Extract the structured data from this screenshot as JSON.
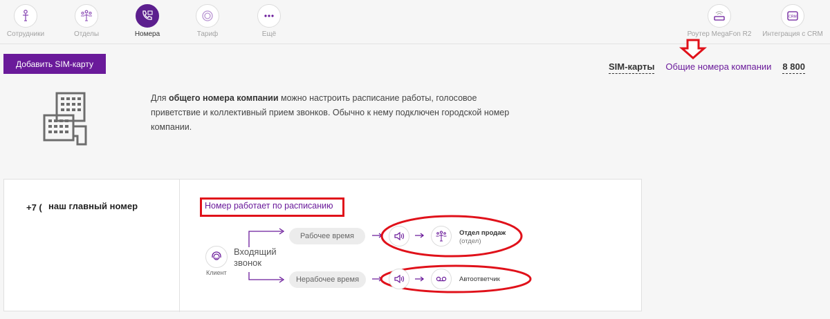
{
  "nav": {
    "items": [
      {
        "label": "Сотрудники",
        "icon": "employee-icon"
      },
      {
        "label": "Отделы",
        "icon": "departments-icon"
      },
      {
        "label": "Номера",
        "icon": "phone-icon"
      },
      {
        "label": "Тариф",
        "icon": "tariff-icon"
      },
      {
        "label": "Ещё",
        "icon": "more-icon"
      }
    ],
    "right_items": [
      {
        "label": "Роутер MegaFon R2",
        "icon": "router-icon"
      },
      {
        "label": "Интеграция с CRM",
        "icon": "crm-icon",
        "badge": "CRM"
      }
    ]
  },
  "toolbar": {
    "add_sim_label": "Добавить SIM-карту"
  },
  "tabs": {
    "sim": "SIM-карты",
    "company": "Общие номера компании",
    "eight": "8 800"
  },
  "info": {
    "prefix": "Для ",
    "bold": "общего номера компании",
    "rest": " можно настроить расписание работы, голосовое приветствие и коллективный прием звонков. Обычно к нему подключен городской номер компании."
  },
  "card": {
    "number": "+7 (",
    "name": "наш главный номер",
    "schedule_link": "Номер работает по расписанию",
    "client_label": "Клиент",
    "incoming": "Входящий звонок",
    "work_time": "Рабочее время",
    "nonwork_time": "Нерабочее время",
    "dest_work_title": "Отдел продаж",
    "dest_work_sub": "(отдел)",
    "dest_nonwork": "Автоответчик"
  },
  "colors": {
    "accent": "#6a1a9a",
    "highlight": "#e0111a"
  }
}
